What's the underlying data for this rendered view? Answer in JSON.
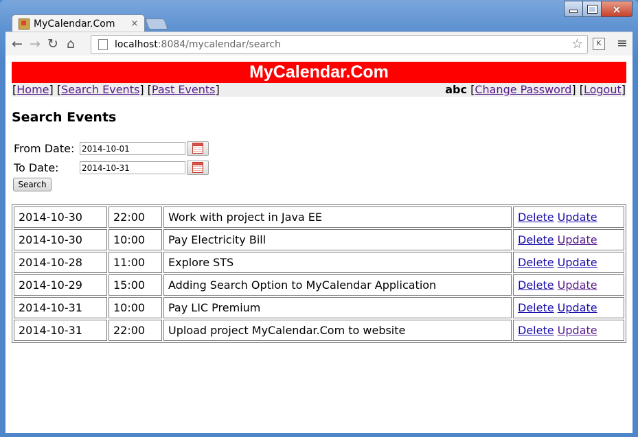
{
  "browser": {
    "tab_title": "MyCalendar.Com",
    "tab_close": "×",
    "url_host": "localhost",
    "url_path": ":8084/mycalendar/search",
    "bookmark_icon": "star-icon",
    "extension_label": "K",
    "menu_icon": "hamburger-menu-icon",
    "window_close": "×"
  },
  "site": {
    "banner": "MyCalendar.Com",
    "nav": {
      "home": "Home",
      "search_events": "Search Events",
      "past_events": "Past Events",
      "username": "abc",
      "change_password": "Change Password",
      "logout": "Logout"
    }
  },
  "search_form": {
    "heading": "Search Events",
    "from_label": "From Date:",
    "from_value": "2014-10-01",
    "to_label": "To Date:",
    "to_value": "2014-10-31",
    "search_button": "Search"
  },
  "events": [
    {
      "date": "2014-10-30",
      "time": "22:00",
      "title": "Work with project in Java EE",
      "delete": "Delete",
      "update": "Update"
    },
    {
      "date": "2014-10-30",
      "time": "10:00",
      "title": "Pay Electricity Bill",
      "delete": "Delete",
      "update": "Update"
    },
    {
      "date": "2014-10-28",
      "time": "11:00",
      "title": "Explore STS",
      "delete": "Delete",
      "update": "Update"
    },
    {
      "date": "2014-10-29",
      "time": "15:00",
      "title": "Adding Search Option to MyCalendar Application",
      "delete": "Delete",
      "update": "Update"
    },
    {
      "date": "2014-10-31",
      "time": "10:00",
      "title": "Pay LIC Premium",
      "delete": "Delete",
      "update": "Update"
    },
    {
      "date": "2014-10-31",
      "time": "22:00",
      "title": "Upload project MyCalendar.Com to website",
      "delete": "Delete",
      "update": "Update"
    }
  ]
}
